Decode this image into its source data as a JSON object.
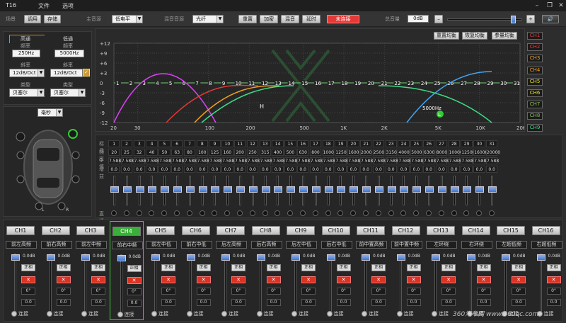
{
  "app": {
    "title": "T16",
    "menu": [
      "文件",
      "选项"
    ]
  },
  "toolbar": {
    "scene_label": "场景",
    "btn_call": "调用",
    "btn_save": "存储",
    "main_src_label": "主音源",
    "main_src": "低电平",
    "mix_src_label": "混音音源",
    "mix_src": "光纤",
    "btn_reset": "重置",
    "btn_encrypt": "加密",
    "btn_surround": "混音",
    "btn_delay": "延时",
    "btn_connect": "未连接",
    "connect_color": "#e53935",
    "master_label": "总音量",
    "master_value": "0dB",
    "master_level_fraction": 0.86
  },
  "filters": {
    "hp_title": "高通",
    "lp_title": "低通",
    "freq_label": "频率",
    "hp_freq": "250Hz",
    "lp_freq": "5000Hz",
    "slope_label": "斜率",
    "hp_slope": "12dB/Oct",
    "lp_slope": "12dB/Oct",
    "type_label": "类型",
    "hp_type": "贝塞尔",
    "lp_type": "贝塞尔",
    "unit": "毫秒"
  },
  "eq": {
    "btn_reset_eq": "重置均衡",
    "btn_restore_eq": "恢复均衡",
    "btn_param_eq": "参量均衡",
    "y_ticks": [
      "+12",
      "+9",
      "+6",
      "+3",
      "0",
      "-3",
      "-6",
      "-9",
      "-12"
    ],
    "x_ticks": [
      "20",
      "30",
      "100",
      "200",
      "500",
      "1K",
      "2K",
      "5K",
      "10K",
      "20K"
    ],
    "points": [
      "1",
      "2",
      "3",
      "4",
      "5",
      "6",
      "7",
      "8",
      "9",
      "10",
      "11",
      "12",
      "13",
      "14",
      "15",
      "16",
      "17",
      "18",
      "19",
      "20",
      "21",
      "22",
      "23",
      "24",
      "25",
      "26",
      "27",
      "28",
      "29",
      "30",
      "31"
    ],
    "marker_h": "H",
    "marker_l": "L",
    "marker_freq": "5000Hz",
    "row_labels": {
      "index": "标号",
      "freq": "频率",
      "q": "Q 值",
      "gain": "增益",
      "through": "直通"
    },
    "freqs": [
      "20",
      "25",
      "32",
      "40",
      "50",
      "63",
      "80",
      "100",
      "125",
      "160",
      "200",
      "250",
      "315",
      "400",
      "500",
      "630",
      "800",
      "1000",
      "1250",
      "1600",
      "2000",
      "2500",
      "3150",
      "4000",
      "5000",
      "6300",
      "8000",
      "10000",
      "12500",
      "16000",
      "20000"
    ],
    "q": "7.588",
    "gain": "0.0"
  },
  "ch_selectors": [
    {
      "label": "CH1",
      "color": "#e53935"
    },
    {
      "label": "CH2",
      "color": "#e53935"
    },
    {
      "label": "CH3",
      "color": "#f0a020"
    },
    {
      "label": "CH4",
      "color": "#f0a020"
    },
    {
      "label": "CH5",
      "color": "#e8e020"
    },
    {
      "label": "CH6",
      "color": "#e8e020"
    },
    {
      "label": "CH7",
      "color": "#8bc34a"
    },
    {
      "label": "CH8",
      "color": "#8bc34a"
    },
    {
      "label": "CH9",
      "color": "#3ddc84"
    },
    {
      "label": "CH10",
      "color": "#3ddc84"
    },
    {
      "label": "CH11",
      "color": "#42a5f5"
    },
    {
      "label": "CH12",
      "color": "#42a5f5"
    },
    {
      "label": "CH13",
      "color": "#9575cd"
    },
    {
      "label": "CH14",
      "color": "#9575cd"
    },
    {
      "label": "CH15",
      "color": "#e040fb"
    },
    {
      "label": "CH16",
      "color": "#e040fb"
    }
  ],
  "channels": [
    {
      "label": "CH1",
      "name": "前左高频"
    },
    {
      "label": "CH2",
      "name": "前右高频"
    },
    {
      "label": "CH3",
      "name": "前左中频"
    },
    {
      "label": "CH4",
      "name": "前右中频",
      "active": true
    },
    {
      "label": "CH5",
      "name": "前左中低"
    },
    {
      "label": "CH6",
      "name": "前右中低"
    },
    {
      "label": "CH7",
      "name": "后左高频"
    },
    {
      "label": "CH8",
      "name": "后右高频"
    },
    {
      "label": "CH9",
      "name": "后左中低"
    },
    {
      "label": "CH10",
      "name": "后右中低"
    },
    {
      "label": "CH11",
      "name": "前中置高频"
    },
    {
      "label": "CH12",
      "name": "前中置中频"
    },
    {
      "label": "CH13",
      "name": "左环绕"
    },
    {
      "label": "CH14",
      "name": "右环绕"
    },
    {
      "label": "CH15",
      "name": "左超低频"
    },
    {
      "label": "CH16",
      "name": "右超低频"
    }
  ],
  "strip": {
    "gain": "0.0dB",
    "phase": "正相",
    "delay": "0°",
    "ms": "0.0",
    "link": "连接"
  },
  "car": {
    "left": "L",
    "right": "R"
  },
  "watermark": "360汽车网  www.360qc.com"
}
